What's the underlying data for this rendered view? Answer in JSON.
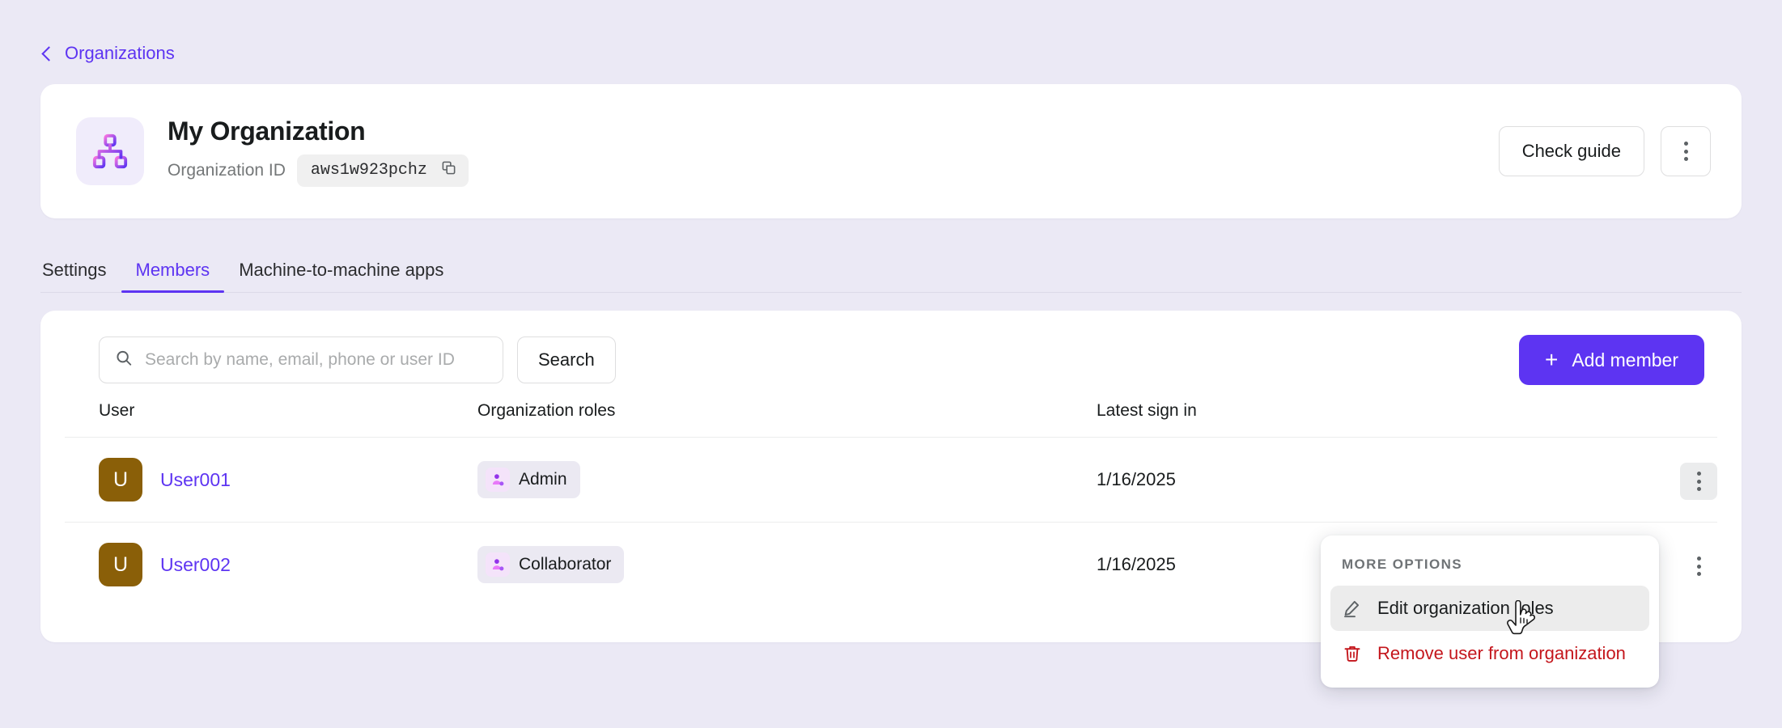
{
  "breadcrumb": {
    "back_label": "Organizations",
    "icon": "chevron-left-icon"
  },
  "header": {
    "org_icon": "sitemap-icon",
    "title": "My Organization",
    "org_id_label": "Organization ID",
    "org_id_value": "aws1w923pchz",
    "copy_icon": "copy-icon",
    "check_guide_label": "Check guide",
    "more_icon": "dots-vertical-icon"
  },
  "tabs": [
    {
      "label": "Settings",
      "active": false
    },
    {
      "label": "Members",
      "active": true
    },
    {
      "label": "Machine-to-machine apps",
      "active": false
    }
  ],
  "toolbar": {
    "search_placeholder": "Search by name, email, phone or user ID",
    "search_value": "",
    "search_icon": "search-icon",
    "search_button_label": "Search",
    "add_member_label": "Add member",
    "add_icon": "plus-icon"
  },
  "table": {
    "columns": [
      "User",
      "Organization roles",
      "Latest sign in"
    ],
    "rows": [
      {
        "avatar_initial": "U",
        "user_name": "User001",
        "role": "Admin",
        "role_icon": "user-role-icon",
        "latest_sign_in": "1/16/2025",
        "menu_icon": "dots-vertical-icon"
      },
      {
        "avatar_initial": "U",
        "user_name": "User002",
        "role": "Collaborator",
        "role_icon": "user-role-icon",
        "latest_sign_in": "1/16/2025",
        "menu_icon": "dots-vertical-icon"
      }
    ]
  },
  "dropdown": {
    "title": "MORE OPTIONS",
    "items": [
      {
        "label": "Edit organization roles",
        "icon": "pencil-icon",
        "danger": false,
        "hovered": true
      },
      {
        "label": "Remove user from organization",
        "icon": "trash-icon",
        "danger": true,
        "hovered": false
      }
    ]
  },
  "colors": {
    "page_background": "#ebe9f5",
    "card_background": "#ffffff",
    "accent_purple": "#5d34f2",
    "danger_red": "#c4161c",
    "avatar_brown": "#8a5f08",
    "chip_gray": "#ebe9f2"
  }
}
